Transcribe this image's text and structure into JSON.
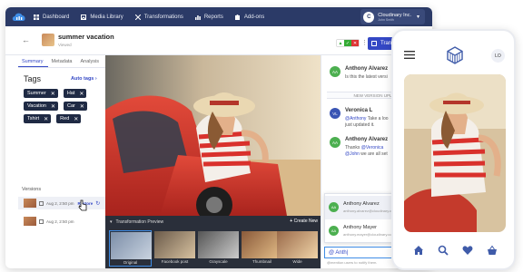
{
  "nav": {
    "items": [
      {
        "label": "Dashboard",
        "icon": "grid-icon"
      },
      {
        "label": "Media Library",
        "icon": "image-stack-icon"
      },
      {
        "label": "Transformations",
        "icon": "transform-icon"
      },
      {
        "label": "Reports",
        "icon": "bar-chart-icon"
      },
      {
        "label": "Add-ons",
        "icon": "puzzle-icon"
      }
    ],
    "account": {
      "initial": "C",
      "name": "Cloudinary Inc.",
      "sub": "John Smith"
    }
  },
  "asset": {
    "title": "summer vacation",
    "subtitle": "Viewed"
  },
  "toolbar": {
    "transform_label": "Transform"
  },
  "left": {
    "tabs": [
      "Summary",
      "Metadata",
      "Analysis"
    ],
    "tags_heading": "Tags",
    "auto_tags": "Auto tags",
    "tags": [
      "Summer",
      "Hat",
      "Vacation",
      "Car",
      "Tshirt",
      "Red"
    ],
    "versions_heading": "Versions",
    "versions": [
      {
        "date": "Aug 2, 2:50 pm",
        "action": "Restore"
      },
      {
        "date": "Aug 2, 2:50 pm",
        "action": ""
      }
    ]
  },
  "preview": {
    "heading": "Transformation Preview",
    "create_new": "Create New",
    "cards": [
      "Original",
      "Facebook post",
      "Grayscale",
      "Thumbnail",
      "Wide"
    ]
  },
  "comments": {
    "items": [
      {
        "initials": "AA",
        "name": "Anthony Alvarez",
        "text": "Is this the latest versi"
      },
      {
        "initials": "VL",
        "name": "Veronica L",
        "text_mention": "@Anthony",
        "text": " Take a loo",
        "text2": "just updated it."
      },
      {
        "initials": "AA",
        "name": "Anthony Alvarez",
        "text": "Thanks ",
        "text_mention": "@Veronica",
        "text2_mention": "@John",
        "text2": " we are all set"
      }
    ],
    "version_update": "NEW VERSION UPLOADED",
    "suggestions": [
      {
        "initials": "AA",
        "name": "Anthony Alvarez",
        "email": "anthony.alvarez@cloudinary.com"
      },
      {
        "initials": "AA",
        "name": "Anthony Mayer",
        "email": "anthony.mayer@cloudinary.com"
      }
    ],
    "input_value": "@ Anth|",
    "note": "@mention users to notify them."
  },
  "phone": {
    "user_initials": "LO"
  },
  "colors": {
    "nav_bg": "#2b3a67",
    "accent": "#3448c5",
    "tag_bg": "#1f2a44"
  }
}
